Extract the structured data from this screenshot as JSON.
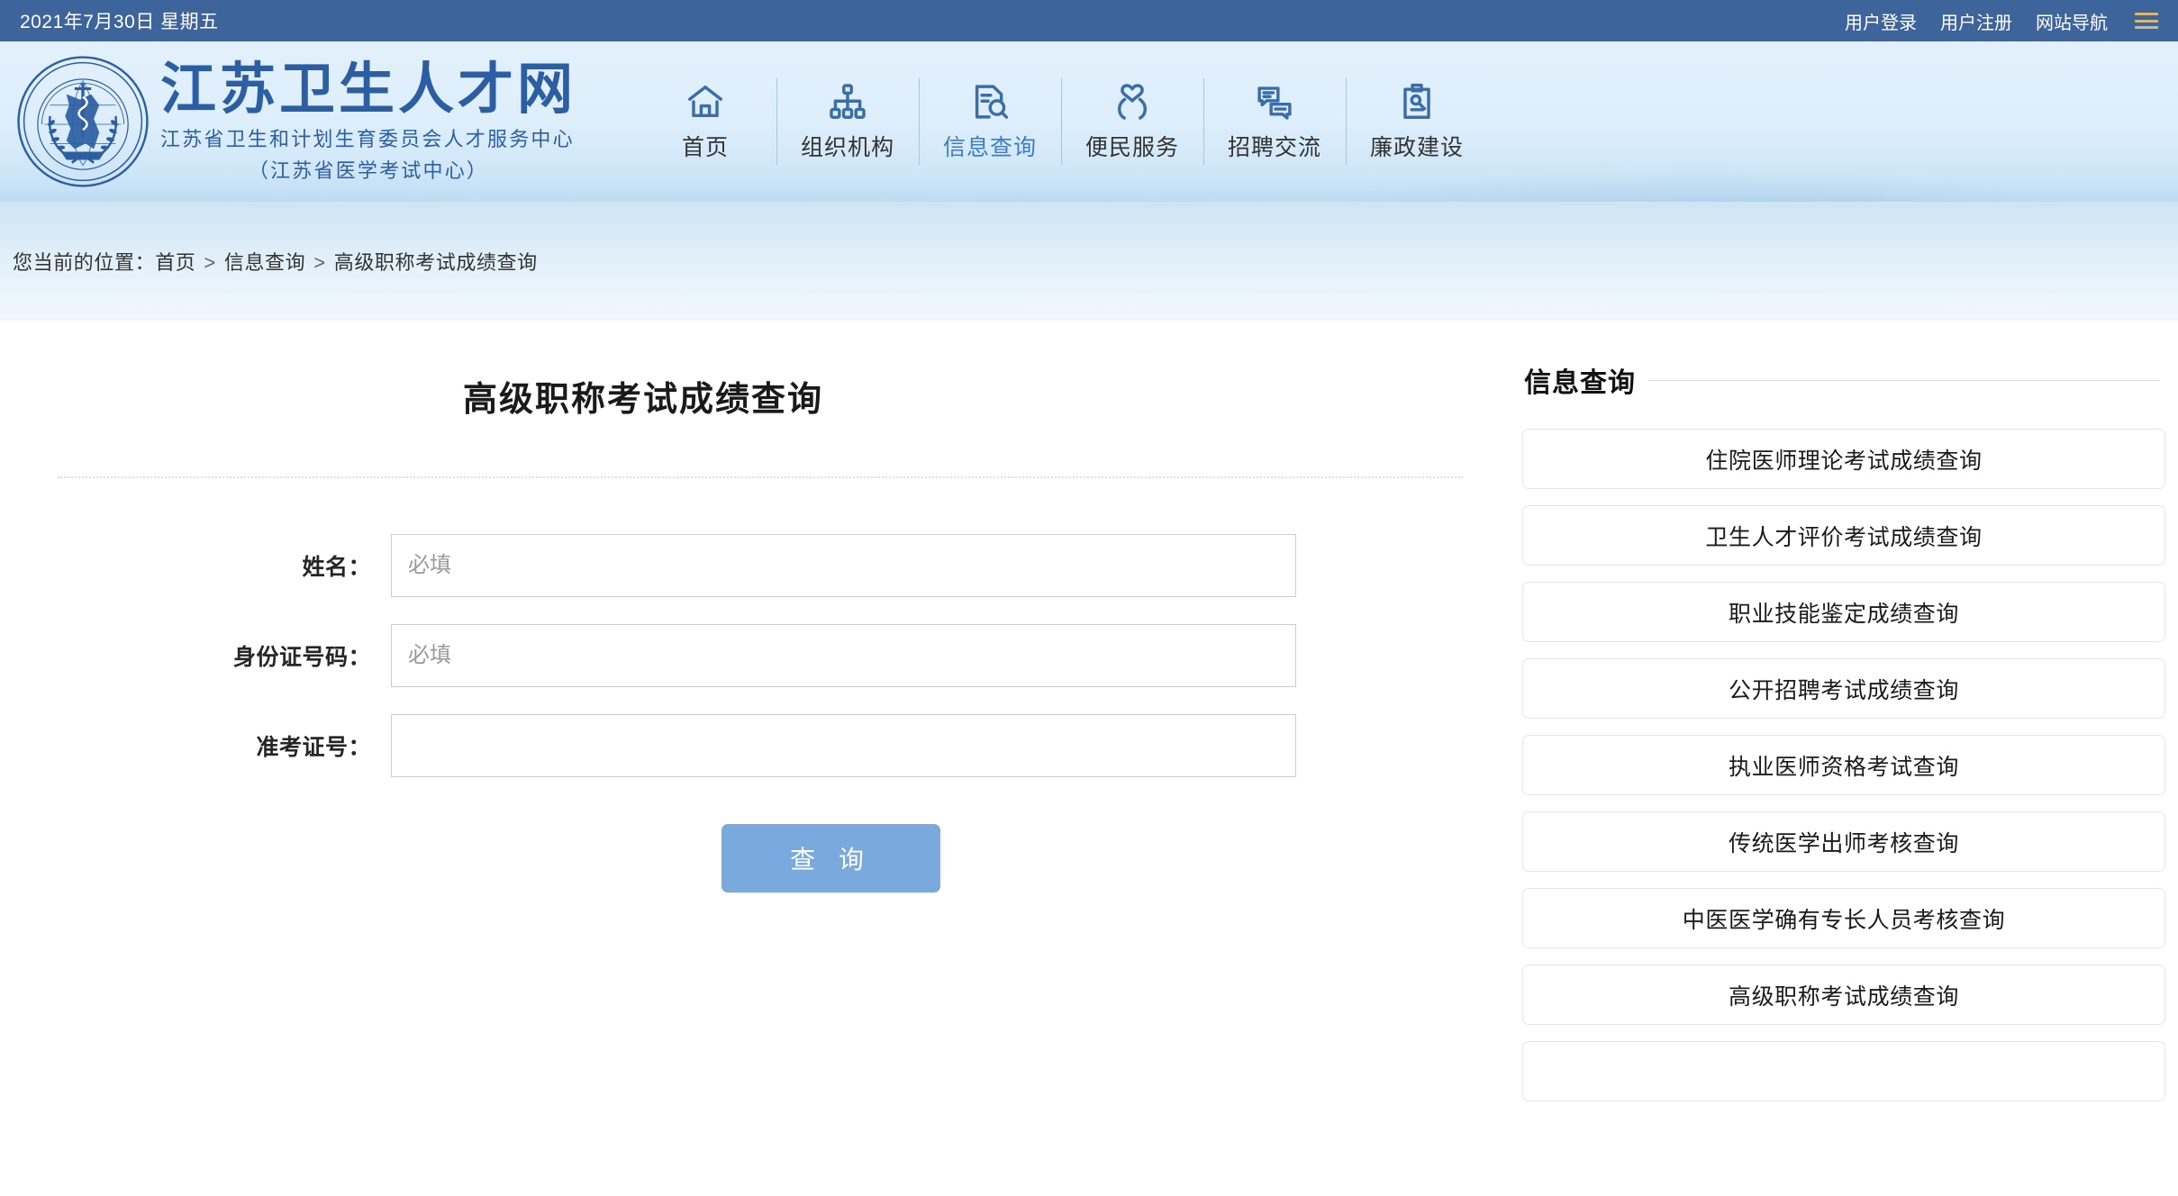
{
  "topbar": {
    "date": "2021年7月30日 星期五",
    "links": [
      {
        "label": "用户登录",
        "name": "user-login-link"
      },
      {
        "label": "用户注册",
        "name": "user-register-link"
      },
      {
        "label": "网站导航",
        "name": "site-nav-link"
      }
    ],
    "menu_icon": "hamburger-icon",
    "background": "#3e649c",
    "menu_icon_color": "#d6b77a"
  },
  "brand": {
    "emblem_alt": "江苏省卫生和计划生育委员会人才服务中心徽章",
    "title": "江苏卫生人才网",
    "subtitle1": "江苏省卫生和计划生育委员会人才服务中心",
    "subtitle2": "（江苏省医学考试中心）",
    "color": "#2b5ea3"
  },
  "mainnav": {
    "items": [
      {
        "label": "首页",
        "icon": "home-icon",
        "active": false
      },
      {
        "label": "组织机构",
        "icon": "org-chart-icon",
        "active": false
      },
      {
        "label": "信息查询",
        "icon": "document-search-icon",
        "active": true
      },
      {
        "label": "便民服务",
        "icon": "heart-hands-icon",
        "active": false
      },
      {
        "label": "招聘交流",
        "icon": "chat-bubbles-icon",
        "active": false
      },
      {
        "label": "廉政建设",
        "icon": "clipboard-icon",
        "active": false
      }
    ],
    "active_color": "#3e7cc0"
  },
  "breadcrumb": {
    "prefix": "您当前的位置：",
    "items": [
      "首页",
      "信息查询",
      "高级职称考试成绩查询"
    ],
    "separator": ">"
  },
  "main": {
    "title": "高级职称考试成绩查询",
    "fields": [
      {
        "label": "姓名：",
        "value": "",
        "placeholder": "必填",
        "name": "name-input"
      },
      {
        "label": "身份证号码：",
        "value": "",
        "placeholder": "必填",
        "name": "id-number-input"
      },
      {
        "label": "准考证号：",
        "value": "",
        "placeholder": "",
        "name": "admission-ticket-input"
      }
    ],
    "submit_label": "查 询",
    "submit_color": "#7aa9dd"
  },
  "sidebar": {
    "title": "信息查询",
    "items": [
      "住院医师理论考试成绩查询",
      "卫生人才评价考试成绩查询",
      "职业技能鉴定成绩查询",
      "公开招聘考试成绩查询",
      "执业医师资格考试查询",
      "传统医学出师考核查询",
      "中医医学确有专长人员考核查询",
      "高级职称考试成绩查询",
      ""
    ]
  }
}
